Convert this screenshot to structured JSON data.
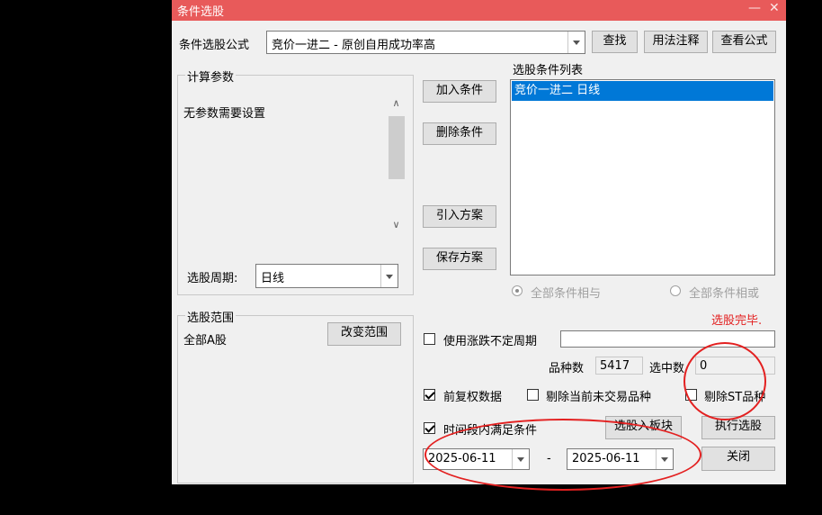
{
  "window": {
    "title": "条件选股",
    "minimize_glyph": "—",
    "close_glyph": "✕"
  },
  "formula": {
    "label": "条件选股公式",
    "value": "竞价一进二 - 原创自用成功率高"
  },
  "top_buttons": {
    "find": "查找",
    "usage": "用法注释",
    "view": "查看公式"
  },
  "params": {
    "title": "计算参数",
    "text": "无参数需要设置"
  },
  "period": {
    "label": "选股周期:",
    "value": "日线"
  },
  "mid_buttons": {
    "add": "加入条件",
    "delete": "删除条件",
    "import": "引入方案",
    "save": "保存方案"
  },
  "conditions": {
    "title": "选股条件列表",
    "items": [
      "竞价一进二 日线"
    ]
  },
  "logic": {
    "and": "全部条件相与",
    "or": "全部条件相或"
  },
  "status": {
    "text": "选股完毕.",
    "color": "#e32020"
  },
  "scope": {
    "title": "选股范围",
    "value": "全部A股",
    "change_button": "改变范围"
  },
  "variable_period": {
    "label": "使用涨跌不定周期",
    "value": ""
  },
  "counts": {
    "total_label": "品种数",
    "total_value": "5417",
    "selected_label": "选中数",
    "selected_value": "0"
  },
  "options": {
    "fq": "前复权数据",
    "exclude_untraded": "剔除当前未交易品种",
    "exclude_st": "剔除ST品种",
    "time_range": "时间段内满足条件"
  },
  "bottom_buttons": {
    "to_block": "选股入板块",
    "execute": "执行选股",
    "close": "关闭"
  },
  "dates": {
    "start": "2025-06-11",
    "separator": "-",
    "end": "2025-06-11"
  }
}
